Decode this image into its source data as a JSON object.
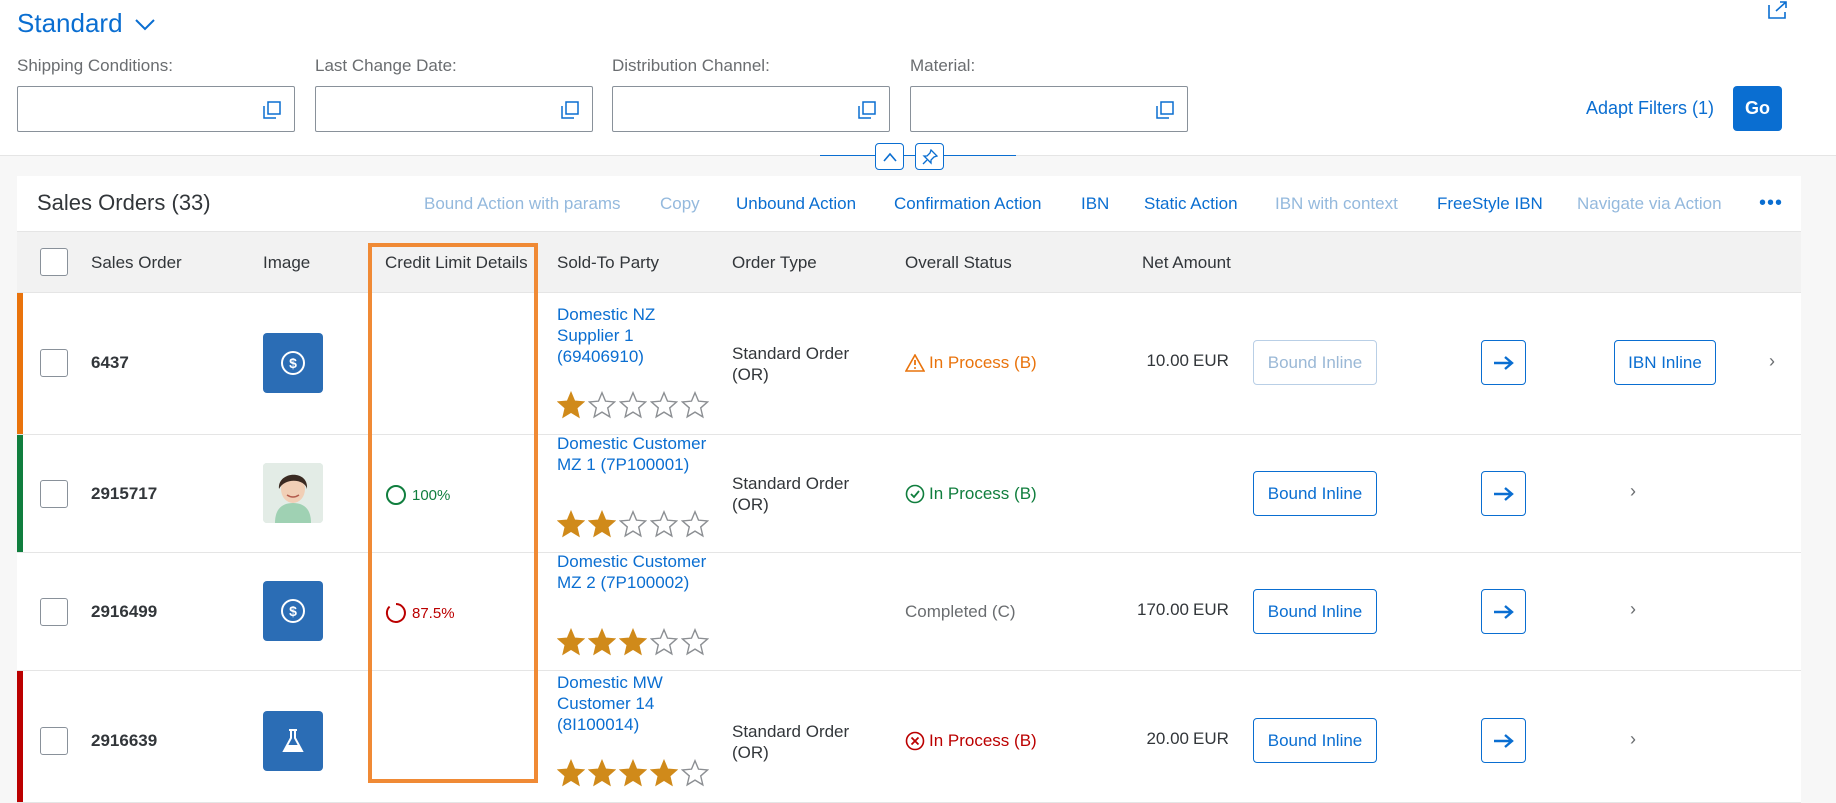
{
  "header": {
    "variant_name": "Standard",
    "filters": [
      {
        "label": "Shipping Conditions:",
        "value": ""
      },
      {
        "label": "Last Change Date:",
        "value": ""
      },
      {
        "label": "Distribution Channel:",
        "value": ""
      },
      {
        "label": "Material:",
        "value": ""
      }
    ],
    "adapt_filters_label": "Adapt Filters (1)",
    "go_label": "Go"
  },
  "table": {
    "title": "Sales Orders (33)",
    "toolbar": [
      {
        "label": "Bound Action with params",
        "enabled": false
      },
      {
        "label": "Copy",
        "enabled": false
      },
      {
        "label": "Unbound Action",
        "enabled": true
      },
      {
        "label": "Confirmation Action",
        "enabled": true
      },
      {
        "label": "IBN",
        "enabled": true
      },
      {
        "label": "Static Action",
        "enabled": true
      },
      {
        "label": "IBN with context",
        "enabled": false
      },
      {
        "label": "FreeStyle IBN",
        "enabled": true
      },
      {
        "label": "Navigate via Action",
        "enabled": false
      }
    ],
    "overflow_label": "•••",
    "columns": [
      "Sales Order",
      "Image",
      "Credit Limit Details",
      "Sold-To Party",
      "Order Type",
      "Overall Status",
      "Net Amount"
    ],
    "rows": [
      {
        "sales_order": "6437",
        "image": "dollar-icon",
        "credit": "",
        "sold_to_line1": "Domestic NZ",
        "sold_to_line2": "Supplier 1",
        "sold_to_line3": "(69406910)",
        "rating": 1,
        "order_type_line1": "Standard Order",
        "order_type_line2": "(OR)",
        "status": "In Process (B)",
        "status_icon": "warning-icon",
        "status_color": "#e9730c",
        "amount": "10.00",
        "currency": "EUR",
        "bound_label": "Bound Inline",
        "ibn_label": "IBN Inline",
        "highlight": "#e9730c"
      },
      {
        "sales_order": "2915717",
        "image": "person-photo",
        "credit": "100%",
        "credit_color": "#107e3e",
        "sold_to_line1": "Domestic Customer",
        "sold_to_line2": "MZ 1 (7P100001)",
        "sold_to_line3": "",
        "rating": 2,
        "order_type_line1": "Standard Order",
        "order_type_line2": "(OR)",
        "status": "In Process (B)",
        "status_icon": "check-circle-icon",
        "status_color": "#107e3e",
        "amount": "",
        "currency": "",
        "bound_label": "Bound Inline",
        "highlight": "#107e3e"
      },
      {
        "sales_order": "2916499",
        "image": "dollar-icon",
        "credit": "87.5%",
        "credit_color": "#bb0000",
        "sold_to_line1": "Domestic Customer",
        "sold_to_line2": "MZ 2 (7P100002)",
        "sold_to_line3": "",
        "rating": 3,
        "order_type_line1": "",
        "order_type_line2": "",
        "status": "Completed (C)",
        "status_color": "#6a6d70",
        "amount": "170.00",
        "currency": "EUR",
        "bound_label": "Bound Inline",
        "highlight": ""
      },
      {
        "sales_order": "2916639",
        "image": "flask-icon",
        "credit": "",
        "sold_to_line1": "Domestic MW",
        "sold_to_line2": "Customer 14",
        "sold_to_line3": "(8I100014)",
        "rating": 4,
        "order_type_line1": "Standard Order",
        "order_type_line2": "(OR)",
        "status": "In Process (B)",
        "status_icon": "error-circle-icon",
        "status_color": "#bb0000",
        "amount": "20.00",
        "currency": "EUR",
        "bound_label": "Bound Inline",
        "highlight": "#bb0000"
      }
    ]
  }
}
